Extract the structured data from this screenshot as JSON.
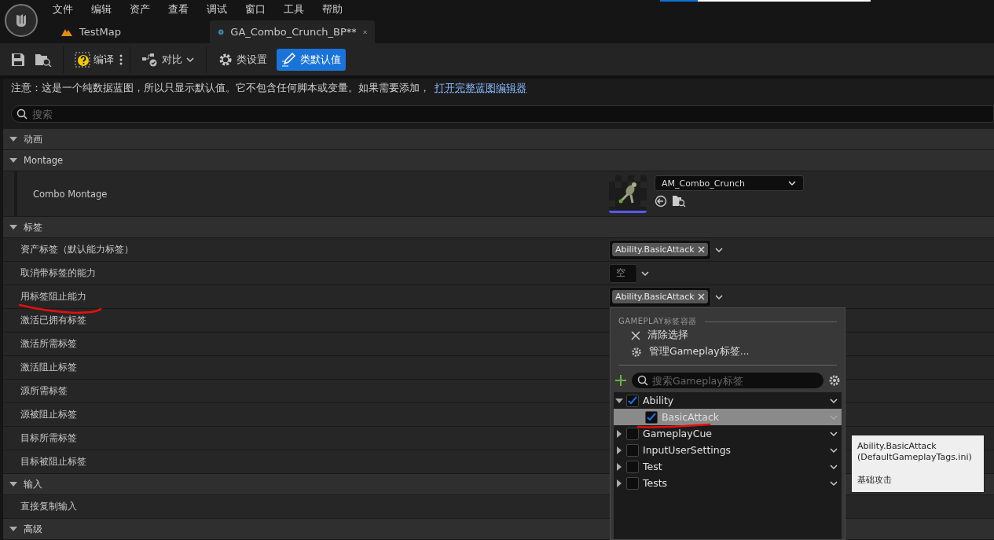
{
  "progress_bar": {
    "level": 0.18
  },
  "menu": [
    "文件",
    "编辑",
    "资产",
    "查看",
    "调试",
    "窗口",
    "工具",
    "帮助"
  ],
  "tabs": [
    {
      "label": "TestMap",
      "kind": "level",
      "selected": false
    },
    {
      "label": "GA_Combo_Crunch_BP**",
      "kind": "blueprint",
      "selected": true
    }
  ],
  "toolbar": [
    {
      "kind": "save"
    },
    {
      "kind": "browse"
    },
    {
      "kind": "compile",
      "label": "编译"
    },
    {
      "kind": "diff",
      "label": "对比"
    },
    {
      "kind": "class-settings",
      "label": "类设置",
      "selected": false
    },
    {
      "kind": "class-defaults",
      "label": "类默认值",
      "selected": true
    }
  ],
  "notice": {
    "text": "注意：这是一个纯数据蓝图，所以只显示默认值。它不包含任何脚本或变量。如果需要添加，",
    "link": "打开完整蓝图编辑器"
  },
  "search": {
    "placeholder": "搜索"
  },
  "sections": [
    {
      "title": "动画",
      "expanded": true
    },
    {
      "title": "Montage",
      "expanded": true,
      "rows": [
        {
          "label": "Combo Montage",
          "value": {
            "kind": "asset",
            "asset": "AM_Combo_Crunch"
          }
        }
      ]
    },
    {
      "title": "标签",
      "expanded": true,
      "rows": [
        {
          "label": "资产标签（默认能力标签）",
          "value": {
            "kind": "tags",
            "tags": [
              "Ability.BasicAttack"
            ]
          }
        },
        {
          "label": "取消带标签的能力",
          "value": {
            "kind": "empty",
            "text": "空"
          }
        },
        {
          "label": "用标签阻止能力",
          "value": {
            "kind": "tags",
            "tags": [
              "Ability.BasicAttack"
            ]
          }
        },
        {
          "label": "激活已拥有标签"
        },
        {
          "label": "激活所需标签"
        },
        {
          "label": "激活阻止标签"
        },
        {
          "label": "源所需标签"
        },
        {
          "label": "源被阻止标签"
        },
        {
          "label": "目标所需标签"
        },
        {
          "label": "目标被阻止标签"
        }
      ]
    },
    {
      "title": "输入",
      "expanded": true,
      "rows": [
        {
          "label": "直接复制输入"
        }
      ]
    },
    {
      "title": "高级",
      "expanded": true
    }
  ],
  "tag_popup": {
    "title": "GAMEPLAY标签容器",
    "actions": [
      {
        "kind": "clear",
        "label": "清除选择"
      },
      {
        "kind": "manage",
        "label": "管理Gameplay标签..."
      }
    ],
    "search_placeholder": "搜索Gameplay标签",
    "tree": [
      {
        "label": "Ability",
        "checked": true,
        "expanded": true,
        "selected": false,
        "children": [
          {
            "label": "BasicAttack",
            "checked": true,
            "selected": true
          }
        ]
      },
      {
        "label": "GameplayCue",
        "checked": false,
        "expanded": false,
        "selected": false
      },
      {
        "label": "InputUserSettings",
        "checked": false,
        "expanded": false,
        "selected": false
      },
      {
        "label": "Test",
        "checked": false,
        "expanded": false,
        "selected": false
      },
      {
        "label": "Tests",
        "checked": false,
        "expanded": false,
        "selected": false
      }
    ]
  },
  "tooltip": {
    "lines": [
      "Ability.BasicAttack",
      "(DefaultGameplayTags.ini)",
      "基础攻击"
    ]
  },
  "annotations": [
    {
      "kind": "underline-stroke"
    },
    {
      "kind": "underline-stroke"
    }
  ]
}
